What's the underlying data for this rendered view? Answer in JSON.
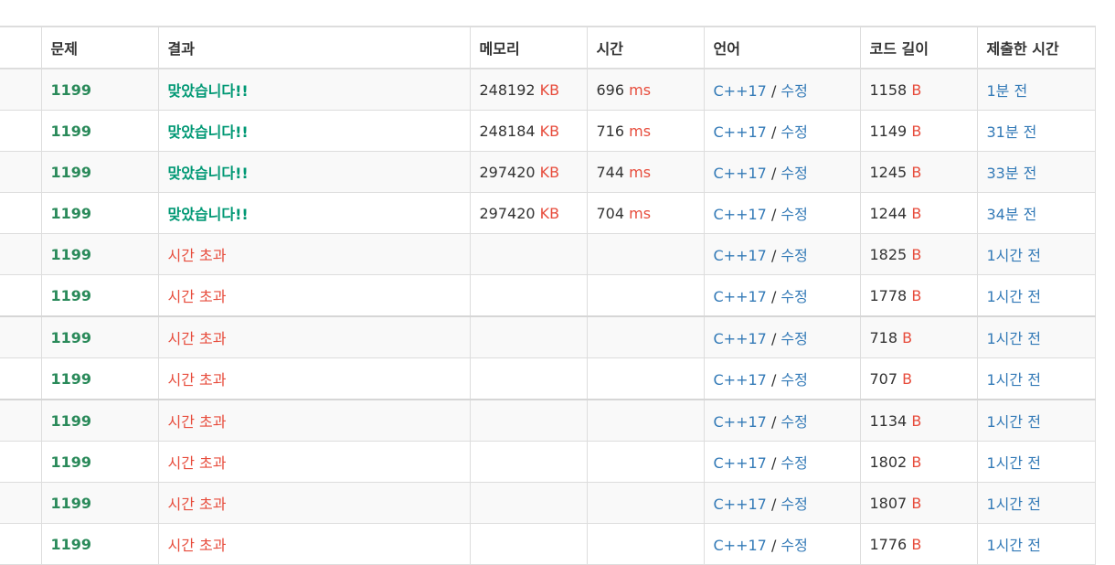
{
  "headers": {
    "problem": "문제",
    "result": "결과",
    "memory": "메모리",
    "time": "시간",
    "language": "언어",
    "code_length": "코드 길이",
    "submitted_time": "제출한 시간"
  },
  "units": {
    "memory": "KB",
    "time": "ms",
    "length": "B"
  },
  "edit_label": "수정",
  "separator": "/",
  "rows": [
    {
      "problem": "1199",
      "result": "맞았습니다!!",
      "status": "ac",
      "memory": "248192",
      "time": "696",
      "language": "C++17",
      "length": "1158",
      "submitted": "1분 전"
    },
    {
      "problem": "1199",
      "result": "맞았습니다!!",
      "status": "ac",
      "memory": "248184",
      "time": "716",
      "language": "C++17",
      "length": "1149",
      "submitted": "31분 전"
    },
    {
      "problem": "1199",
      "result": "맞았습니다!!",
      "status": "ac",
      "memory": "297420",
      "time": "744",
      "language": "C++17",
      "length": "1245",
      "submitted": "33분 전"
    },
    {
      "problem": "1199",
      "result": "맞았습니다!!",
      "status": "ac",
      "memory": "297420",
      "time": "704",
      "language": "C++17",
      "length": "1244",
      "submitted": "34분 전"
    },
    {
      "problem": "1199",
      "result": "시간 초과",
      "status": "tle",
      "memory": "",
      "time": "",
      "language": "C++17",
      "length": "1825",
      "submitted": "1시간 전"
    },
    {
      "problem": "1199",
      "result": "시간 초과",
      "status": "tle",
      "memory": "",
      "time": "",
      "language": "C++17",
      "length": "1778",
      "submitted": "1시간 전"
    },
    {
      "problem": "1199",
      "result": "시간 초과",
      "status": "tle",
      "memory": "",
      "time": "",
      "language": "C++17",
      "length": "718",
      "submitted": "1시간 전"
    },
    {
      "problem": "1199",
      "result": "시간 초과",
      "status": "tle",
      "memory": "",
      "time": "",
      "language": "C++17",
      "length": "707",
      "submitted": "1시간 전"
    },
    {
      "problem": "1199",
      "result": "시간 초과",
      "status": "tle",
      "memory": "",
      "time": "",
      "language": "C++17",
      "length": "1134",
      "submitted": "1시간 전"
    },
    {
      "problem": "1199",
      "result": "시간 초과",
      "status": "tle",
      "memory": "",
      "time": "",
      "language": "C++17",
      "length": "1802",
      "submitted": "1시간 전"
    },
    {
      "problem": "1199",
      "result": "시간 초과",
      "status": "tle",
      "memory": "",
      "time": "",
      "language": "C++17",
      "length": "1807",
      "submitted": "1시간 전"
    },
    {
      "problem": "1199",
      "result": "시간 초과",
      "status": "tle",
      "memory": "",
      "time": "",
      "language": "C++17",
      "length": "1776",
      "submitted": "1시간 전"
    }
  ],
  "colors": {
    "accepted": "#009874",
    "time_limit_exceeded": "#e74c3c",
    "problem_link": "#2a8a5a",
    "link": "#337ab7",
    "unit": "#e74c3c"
  }
}
